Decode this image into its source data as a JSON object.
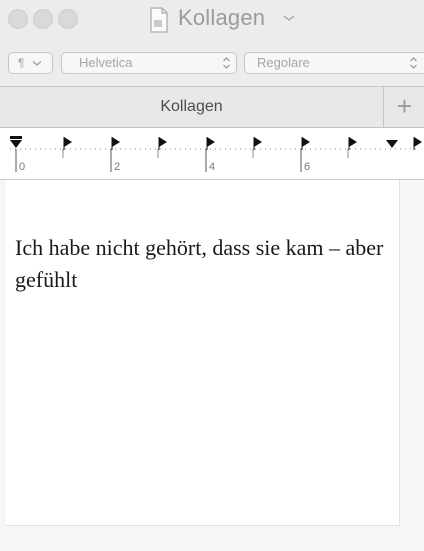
{
  "window": {
    "title": "Kollagen",
    "traffic_lights": [
      "close",
      "minimize",
      "zoom"
    ]
  },
  "toolbar": {
    "paragraph_style": "¶",
    "font_family": "Helvetica",
    "font_style": "Regolare"
  },
  "tabs": [
    {
      "label": "Kollagen",
      "active": true
    }
  ],
  "new_tab_label": "+",
  "ruler": {
    "labels": [
      "0",
      "2",
      "4",
      "6"
    ]
  },
  "document": {
    "text": "Ich habe nicht gehört, dass sie kam – aber gefühlt"
  },
  "colors": {
    "chrome": "#ececec",
    "page": "#ffffff",
    "text": "#1a1a1a"
  }
}
